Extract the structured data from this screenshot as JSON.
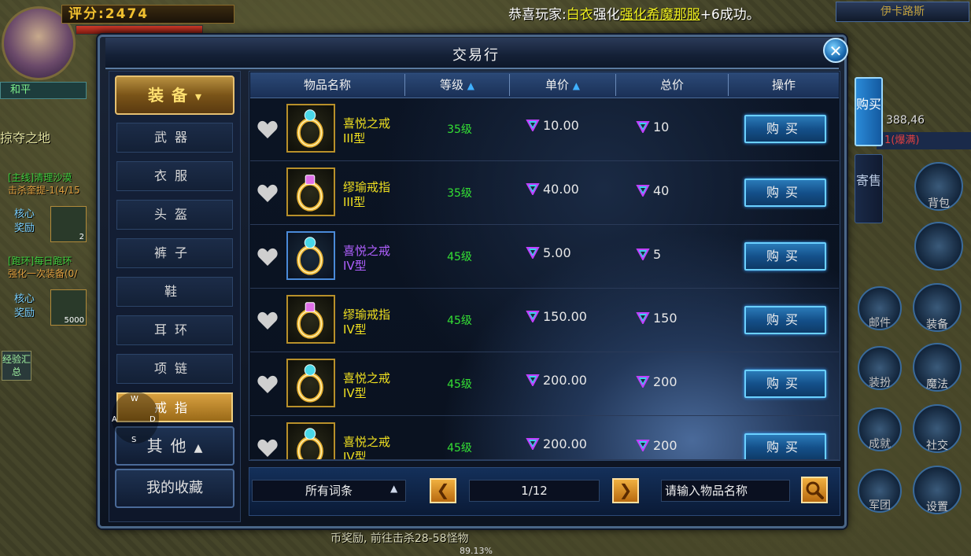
{
  "hud": {
    "score": "评分:2474",
    "peace_mode": "和平",
    "zone_name": "掠夺之地",
    "quest_main_title": "[主线]清理沙漠",
    "quest_main_sub": "击杀奎提-1(4/15",
    "reward_label": "核心奖励",
    "reward_count_1": "2",
    "quest_loop_title": "[跑环]每日跑环",
    "quest_loop_sub": "强化一次装备(0/",
    "reward_count_2": "5000",
    "exp_button": "经验汇总",
    "announcement_prefix": "恭喜玩家:",
    "announcement_player": "白衣",
    "announcement_mid": "强化",
    "announcement_item": "强化希魔那服",
    "announcement_suffix": "+6成功。",
    "map_title": "伊卡路斯",
    "coord": "388,46",
    "map_line": "1(爆满)",
    "bottom_quest": "币奖励,  前往击杀28-58怪物",
    "bottom_pct": "89.13%",
    "right_buttons": [
      "背包",
      "邮件",
      "装备",
      "装扮",
      "魔法",
      "成就",
      "社交",
      "军团",
      "设置"
    ]
  },
  "window": {
    "title": "交易行",
    "close_label": "✕"
  },
  "categories": {
    "header": "装备",
    "header_arrow": "▾",
    "items": [
      "武器",
      "衣服",
      "头盔",
      "裤子",
      "鞋",
      "耳环",
      "项链",
      "戒指"
    ],
    "active_index": 7,
    "other": "其他",
    "other_arrow": "▲",
    "favorites": "我的收藏"
  },
  "wasd": {
    "w": "W",
    "a": "A",
    "s": "S",
    "d": "D"
  },
  "table": {
    "columns": [
      "物品名称",
      "等级",
      "单价",
      "总价",
      "操作"
    ],
    "sort_arrow": "▲",
    "rows": [
      {
        "name_line1": "喜悦之戒",
        "name_line2": "III型",
        "quality": "yellow",
        "gem": "blue",
        "level": "35级",
        "unit_price": "10.00",
        "total": "10",
        "action": "购买"
      },
      {
        "name_line1": "缪瑜戒指",
        "name_line2": "III型",
        "quality": "yellow",
        "gem": "pink",
        "level": "35级",
        "unit_price": "40.00",
        "total": "40",
        "action": "购买"
      },
      {
        "name_line1": "喜悦之戒",
        "name_line2": "IV型",
        "quality": "purple",
        "gem": "blue",
        "level": "45级",
        "unit_price": "5.00",
        "total": "5",
        "action": "购买"
      },
      {
        "name_line1": "缪瑜戒指",
        "name_line2": "IV型",
        "quality": "yellow",
        "gem": "pink",
        "level": "45级",
        "unit_price": "150.00",
        "total": "150",
        "action": "购买"
      },
      {
        "name_line1": "喜悦之戒",
        "name_line2": "IV型",
        "quality": "yellow",
        "gem": "blue",
        "level": "45级",
        "unit_price": "200.00",
        "total": "200",
        "action": "购买"
      },
      {
        "name_line1": "喜悦之戒",
        "name_line2": "IV型",
        "quality": "yellow",
        "gem": "blue",
        "level": "45级",
        "unit_price": "200.00",
        "total": "200",
        "action": "购买"
      }
    ]
  },
  "footer": {
    "filter": "所有词条",
    "filter_caret": "▲",
    "prev": "❮",
    "page": "1/12",
    "next": "❯",
    "search_placeholder": "请输入物品名称"
  },
  "side_tabs": [
    "购买",
    "寄售"
  ],
  "colors": {
    "level": "#34e034",
    "name_yellow": "#f0e020",
    "name_purple": "#b060ff",
    "buy_button": "#14508a",
    "category_active": "#d8a040"
  }
}
